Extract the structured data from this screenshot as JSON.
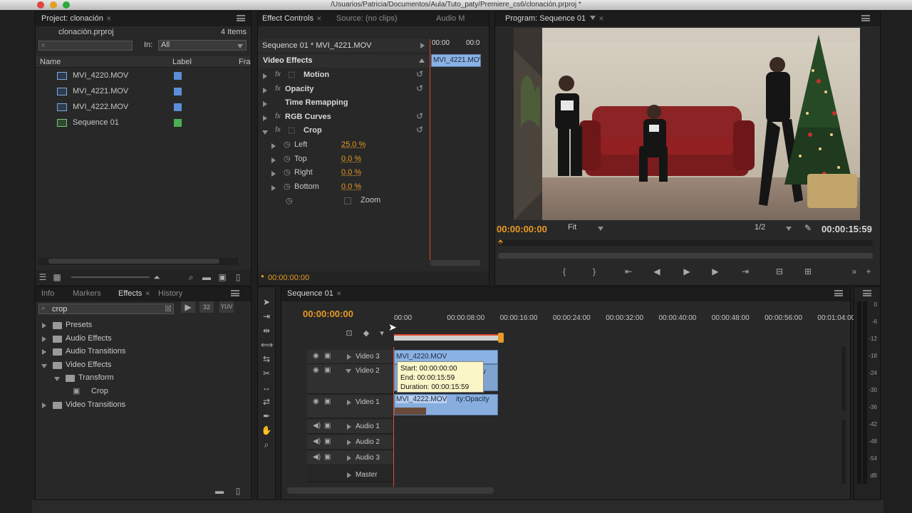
{
  "window": {
    "title": "/Usuarios/Patricia/Documentos/Aula/Tuto_paty/Premiere_cs6/clonación.prproj *"
  },
  "project": {
    "tab": "Project: clonación",
    "file": "clonación.prproj",
    "count": "4 Items",
    "in_label": "In:",
    "in_value": "All",
    "col_name": "Name",
    "col_label": "Label",
    "col_fr": "Fra",
    "items": [
      {
        "name": "MVI_4220.MOV",
        "color": "#5b8ed6"
      },
      {
        "name": "MVI_4221.MOV",
        "color": "#5b8ed6"
      },
      {
        "name": "MVI_4222.MOV",
        "color": "#5b8ed6"
      },
      {
        "name": "Sequence 01",
        "color": "#4caf50"
      }
    ]
  },
  "effect_controls": {
    "tab_active": "Effect Controls",
    "tab_source": "Source: (no clips)",
    "tab_audio": "Audio M",
    "header": "Sequence 01 * MVI_4221.MOV",
    "time_a": "00:00",
    "time_b": "00:0",
    "clip_label": "MVI_4221.MOV",
    "section": "Video Effects",
    "effects": [
      {
        "name": "Motion"
      },
      {
        "name": "Opacity"
      },
      {
        "name": "Time Remapping"
      },
      {
        "name": "RGB Curves"
      },
      {
        "name": "Crop"
      }
    ],
    "crop_params": [
      {
        "name": "Left",
        "value": "25.0 %"
      },
      {
        "name": "Top",
        "value": "0.0 %"
      },
      {
        "name": "Right",
        "value": "0.0 %"
      },
      {
        "name": "Bottom",
        "value": "0.0 %"
      }
    ],
    "zoom_label": "Zoom",
    "timecode": "00:00:00:00"
  },
  "program": {
    "tab": "Program: Sequence 01",
    "timecode": "00:00:00:00",
    "fit": "Fit",
    "quality": "1/2",
    "duration": "00:00:15:59"
  },
  "effects_panel": {
    "tabs": [
      "Info",
      "Markers",
      "Effects",
      "History"
    ],
    "search": "crop",
    "tree": [
      {
        "label": "Presets",
        "depth": 0,
        "open": false
      },
      {
        "label": "Audio Effects",
        "depth": 0,
        "open": false
      },
      {
        "label": "Audio Transitions",
        "depth": 0,
        "open": false
      },
      {
        "label": "Video Effects",
        "depth": 0,
        "open": true
      },
      {
        "label": "Transform",
        "depth": 1,
        "open": true
      },
      {
        "label": "Crop",
        "depth": 2,
        "open": false
      },
      {
        "label": "Video Transitions",
        "depth": 0,
        "open": false
      }
    ]
  },
  "timeline": {
    "tab": "Sequence 01",
    "timecode": "00:00:00:00",
    "ruler": [
      "00:00",
      "00:00:08:00",
      "00:00:16:00",
      "00:00:24:00",
      "00:00:32:00",
      "00:00:40:00",
      "00:00:48:00",
      "00:00:56:00",
      "00:01:04:00"
    ],
    "tracks": [
      "Video 3",
      "Video 2",
      "Video 1",
      "Audio 1",
      "Audio 2",
      "Audio 3",
      "Master"
    ],
    "clip_v3": "MVI_4220.MOV",
    "clip_v1": "MVI_4222.MOV",
    "clip_v1_fx": "ity:Opacity",
    "clip_v2_fx": "ity",
    "tooltip": {
      "start": "Start: 00:00:00:00",
      "end": "End: 00:00:15:59",
      "duration": "Duration: 00:00:15:59"
    }
  },
  "meter": {
    "labels": [
      "0",
      "-6",
      "-12",
      "-18",
      "-24",
      "-30",
      "-36",
      "-42",
      "-48",
      "-54",
      "dB"
    ]
  }
}
